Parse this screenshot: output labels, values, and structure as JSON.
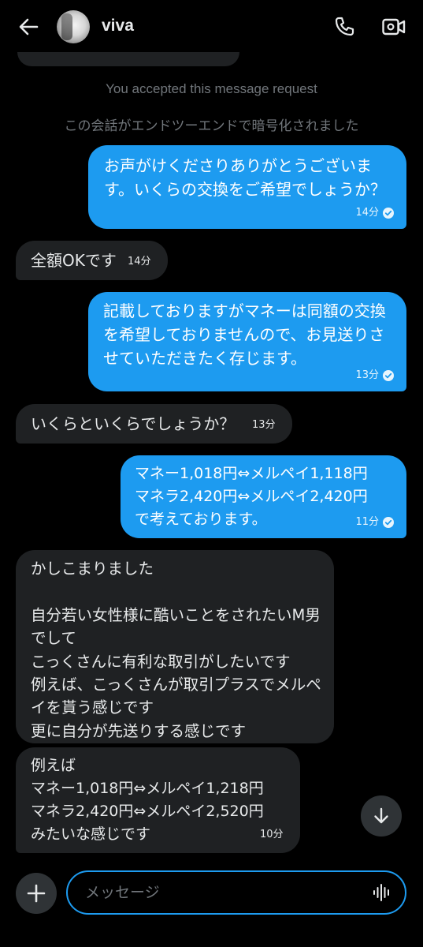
{
  "header": {
    "contact_name": "viva",
    "back_icon": "arrow-left-icon",
    "call_icon": "phone-icon",
    "video_icon": "video-camera-icon"
  },
  "system": {
    "accepted": "You accepted this message request",
    "encrypted": "この会話がエンドツーエンドで暗号化されました"
  },
  "messages": [
    {
      "direction": "sent",
      "text": "お声がけくださりありがとうございます。いくらの交換をご希望でしょうか？",
      "time": "14分",
      "read": true
    },
    {
      "direction": "received",
      "text": "全額OKです",
      "time": "14分"
    },
    {
      "direction": "sent",
      "text": "記載しておりますがマネーは同額の交換を希望しておりませんので、お見送りさせていただきたく存じます。",
      "time": "13分",
      "read": true
    },
    {
      "direction": "received",
      "text": "いくらといくらでしょうか？",
      "time": "13分"
    },
    {
      "direction": "sent",
      "text": "マネー1,018円⇔メルペイ1,118円\nマネラ2,420円⇔メルペイ2,420円\nで考えております。",
      "time": "11分",
      "read": true
    },
    {
      "direction": "received",
      "text": "かしこまりました\n\n自分若い女性様に酷いことをされたいM男でして\nこっくさんに有利な取引がしたいです\n例えば、こっくさんが取引プラスでメルペイを貰う感じです\n更に自分が先送りする感じです"
    },
    {
      "direction": "received",
      "text": "例えば\nマネー1,018円⇔メルペイ1,218円\nマネラ2,420円⇔メルペイ2,520円\nみたいな感じです",
      "time": "10分"
    }
  ],
  "composer": {
    "placeholder": "メッセージ",
    "add_icon": "plus-icon",
    "voice_icon": "voice-waveform-icon"
  },
  "scroll_fab_icon": "arrow-down-icon",
  "colors": {
    "background": "#000000",
    "sent_bubble": "#1d9bf0",
    "received_bubble": "#1f2123",
    "muted_text": "#71767b"
  }
}
